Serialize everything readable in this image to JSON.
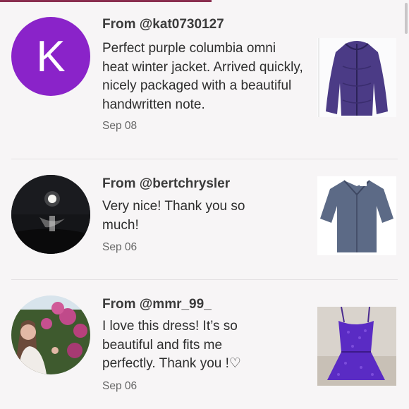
{
  "reviews": [
    {
      "avatar_letter": "K",
      "from": "From @kat0730127",
      "text": "Perfect purple columbia omni heat winter jacket. Arrived quickly, nicely packaged with a beautiful handwritten note.",
      "date": "Sep 08"
    },
    {
      "from": "From @bertchrysler",
      "text": "Very nice! Thank you so much!",
      "date": "Sep 06"
    },
    {
      "from": "From @mmr_99_",
      "text": "I love this dress! It’s so beautiful and fits me perfectly. Thank you !♡",
      "date": "Sep 06"
    }
  ],
  "colors": {
    "avatar_purple": "#8a23c9",
    "accent": "#8a2e4f",
    "background": "#f7f5f6"
  }
}
